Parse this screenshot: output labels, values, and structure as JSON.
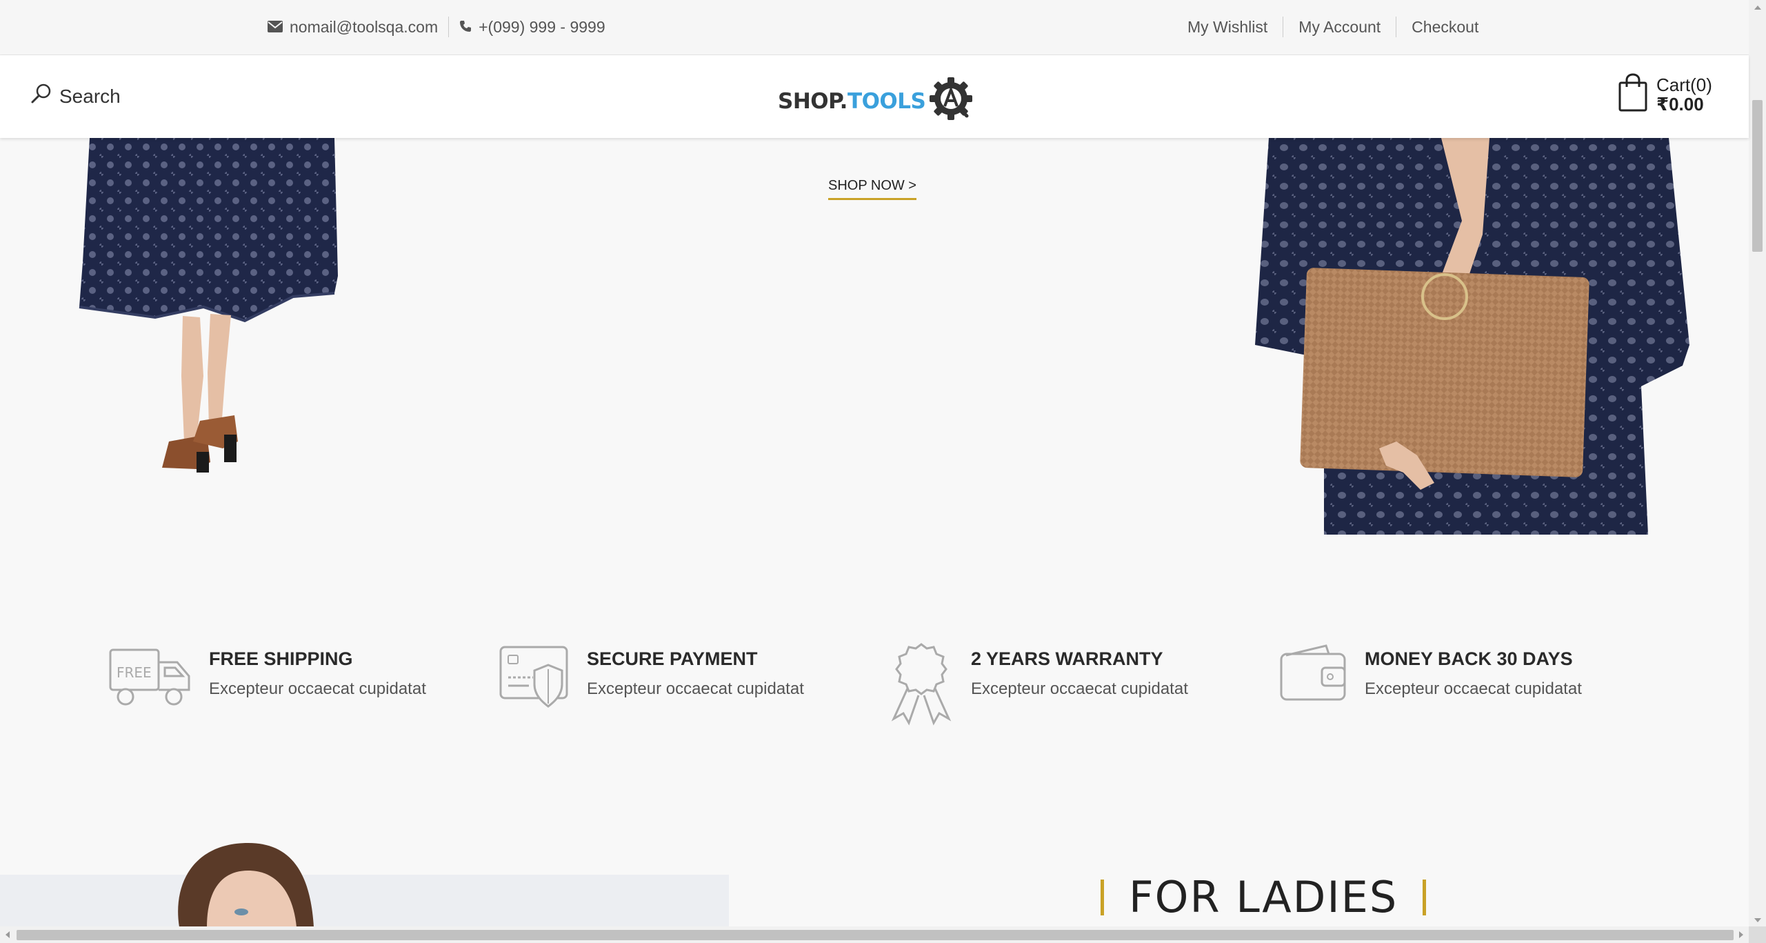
{
  "topbar": {
    "email": "nomail@toolsqa.com",
    "phone": "+(099) 999 - 9999",
    "links": [
      "My Wishlist",
      "My Account",
      "Checkout"
    ]
  },
  "header": {
    "search_label": "Search",
    "logo_part1": "SHOP.",
    "logo_part2": "TOOLS",
    "cart_label": "Cart(0)",
    "cart_total": "₹0.00"
  },
  "hero": {
    "cta": "SHOP NOW >"
  },
  "features": [
    {
      "icon": "free-shipping-truck-icon",
      "icon_text": "FREE",
      "title": "FREE SHIPPING",
      "desc": "Excepteur occaecat cupidatat"
    },
    {
      "icon": "secure-payment-card-icon",
      "title": "SECURE PAYMENT",
      "desc": "Excepteur occaecat cupidatat"
    },
    {
      "icon": "warranty-ribbon-icon",
      "title": "2 YEARS WARRANTY",
      "desc": "Excepteur occaecat cupidatat"
    },
    {
      "icon": "wallet-icon",
      "title": "MONEY BACK 30 DAYS",
      "desc": "Excepteur occaecat cupidatat"
    }
  ],
  "section": {
    "title": "FOR LADIES"
  },
  "colors": {
    "accent": "#c9a227",
    "logo_blue": "#3aa0dc",
    "dress_navy": "#1f2748"
  }
}
